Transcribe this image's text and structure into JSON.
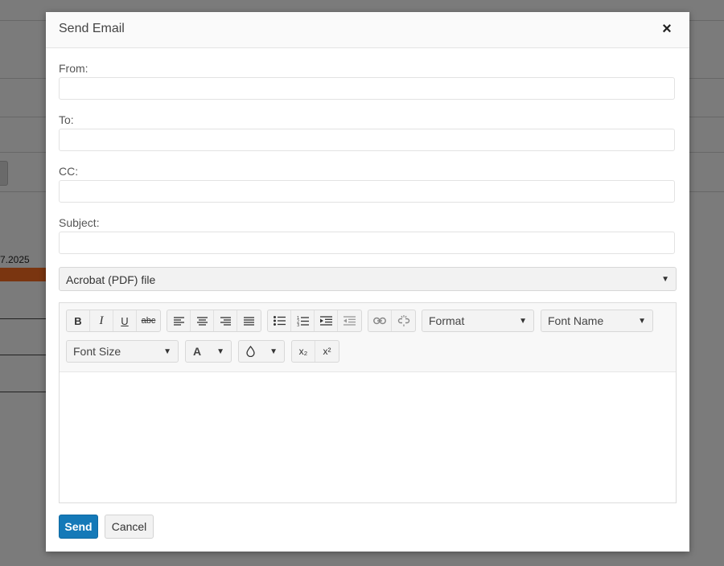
{
  "background": {
    "date_fragment": "7.2025"
  },
  "dialog": {
    "title": "Send Email",
    "close_glyph": "×",
    "from_label": "From:",
    "from_value": "",
    "to_label": "To:",
    "to_value": "",
    "cc_label": "CC:",
    "cc_value": "",
    "subject_label": "Subject:",
    "subject_value": "",
    "attachment_format": "Acrobat (PDF) file",
    "send_label": "Send",
    "cancel_label": "Cancel"
  },
  "toolbar": {
    "bold": "B",
    "italic": "I",
    "underline": "U",
    "strike": "abc",
    "format_label": "Format",
    "font_name_label": "Font Name",
    "font_size_label": "Font Size",
    "text_color_glyph": "A",
    "subscript": "x₂",
    "superscript": "x²",
    "icons": [
      "bold-icon",
      "italic-icon",
      "underline-icon",
      "strikethrough-icon",
      "align-left-icon",
      "align-center-icon",
      "align-right-icon",
      "align-justify-icon",
      "bullet-list-icon",
      "numbered-list-icon",
      "indent-icon",
      "outdent-icon",
      "link-icon",
      "unlink-icon",
      "text-color-icon",
      "background-color-icon",
      "subscript-icon",
      "superscript-icon"
    ]
  },
  "colors": {
    "primary": "#1479b8",
    "overlay": "#7b7b7b"
  }
}
